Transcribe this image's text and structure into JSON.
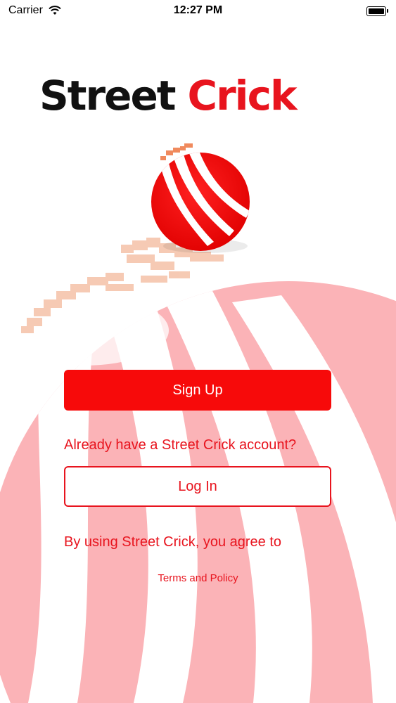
{
  "status_bar": {
    "carrier": "Carrier",
    "time": "12:27 PM"
  },
  "logo": {
    "part1": "Street",
    "part2": "Crick"
  },
  "auth": {
    "signup_label": "Sign Up",
    "have_account_text": "Already have a Street Crick account?",
    "login_label": "Log In",
    "agree_text": "By using Street Crick, you agree to",
    "terms_label": "Terms and Policy"
  },
  "colors": {
    "brand_red": "#e8141e",
    "button_red": "#f70a0a",
    "stripe_pink": "#fbb3b7"
  },
  "icons": {
    "signal": "wifi-icon",
    "battery": "battery-icon",
    "ball": "cricket-ball-icon"
  }
}
